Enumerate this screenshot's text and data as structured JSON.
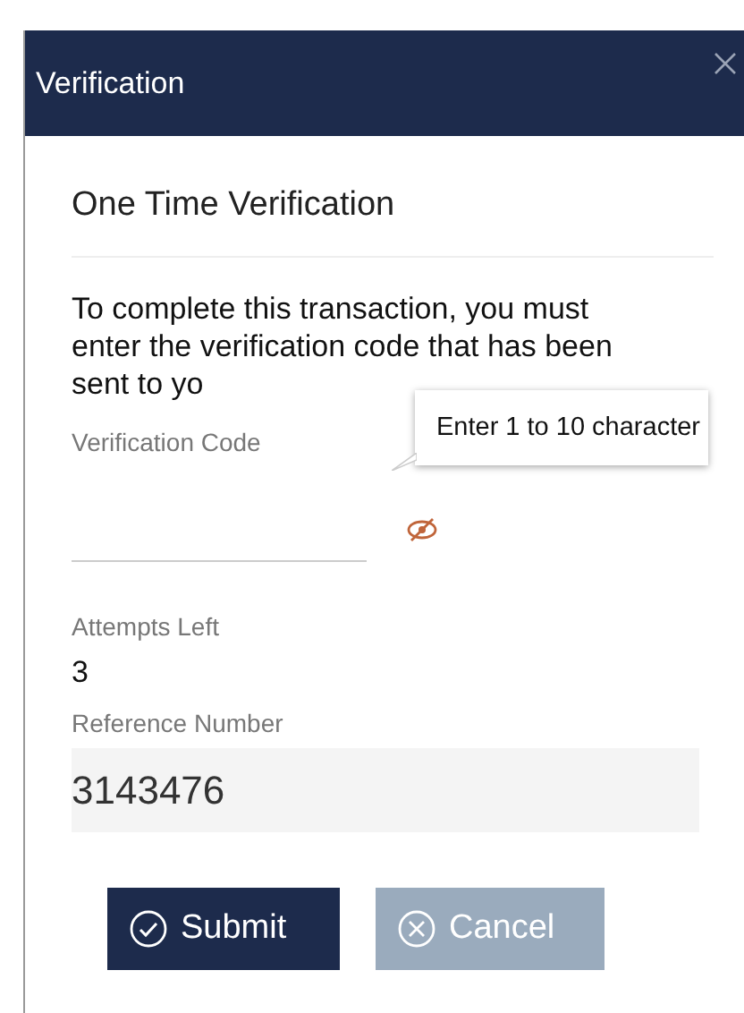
{
  "window": {
    "title": "Verification"
  },
  "heading": "One Time Verification",
  "message": "To complete this transaction, you must enter the verification code that has been sent to yo",
  "code_field": {
    "label": "Verification Code",
    "tooltip": "Enter 1 to 10 character"
  },
  "attempts": {
    "label": "Attempts Left",
    "value": "3"
  },
  "reference": {
    "label": "Reference Number",
    "value": "3143476"
  },
  "buttons": [
    {
      "kind": "submit",
      "label": "Submit",
      "disabled": false
    },
    {
      "kind": "cancel",
      "label": "Cancel",
      "disabled": true
    }
  ]
}
